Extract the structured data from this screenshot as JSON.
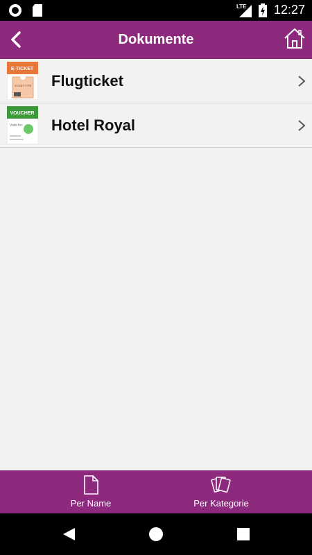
{
  "status_bar": {
    "time": "12:27",
    "network": "LTE",
    "icons": [
      "record-icon",
      "sd-card-icon",
      "signal-icon",
      "battery-charging-icon"
    ]
  },
  "app_bar": {
    "title": "Dokumente",
    "back_icon": "chevron-left-icon",
    "home_icon": "home-icon"
  },
  "documents": [
    {
      "label": "Flugticket",
      "thumb_badge": "E-TICKET",
      "thumb_sub": "ADMIT ONE",
      "icon": "e-ticket-icon"
    },
    {
      "label": "Hotel Royal",
      "thumb_badge": "VOUCHER",
      "thumb_sub": "Valid for:",
      "icon": "voucher-icon"
    }
  ],
  "tabs": [
    {
      "label": "Per Name",
      "icon": "document-icon"
    },
    {
      "label": "Per Kategorie",
      "icon": "cards-icon"
    }
  ],
  "colors": {
    "primary": "#8e2a7e",
    "background": "#f2f2f2",
    "eticket": "#e8773a",
    "voucher": "#3d9a3a"
  }
}
